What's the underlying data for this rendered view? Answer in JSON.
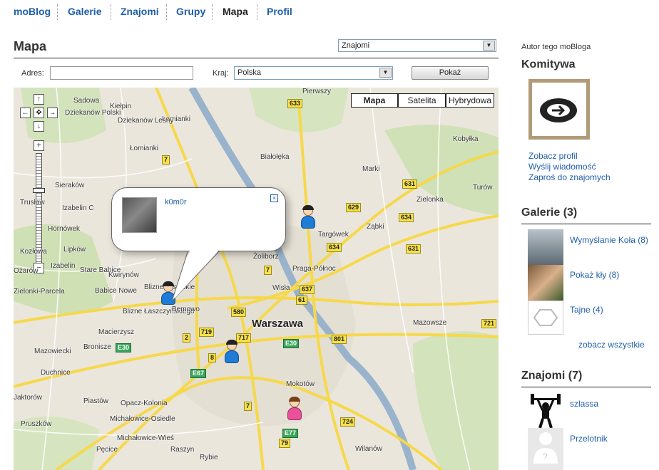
{
  "nav": {
    "items": [
      "moBlog",
      "Galerie",
      "Znajomi",
      "Grupy",
      "Mapa",
      "Profil"
    ],
    "active": "Mapa"
  },
  "page": {
    "title": "Mapa",
    "filter_select": "Znajomi"
  },
  "search": {
    "address_label": "Adres:",
    "address_value": "",
    "country_label": "Kraj:",
    "country_value": "Polska",
    "show_button": "Pokaż"
  },
  "map": {
    "types": [
      "Mapa",
      "Satelita",
      "Hybrydowa"
    ],
    "active_type": "Mapa",
    "center_label": "Warszawa",
    "places": [
      "Sadowa",
      "Kiełpin",
      "Łomianki",
      "Dziekanów Polski",
      "Dziekanów Leśny",
      "Łomianki",
      "Sieraków",
      "Izabelin C",
      "Izabelin",
      "Hornówek",
      "Lipków",
      "Stare Babice",
      "Zielonki-Parcela",
      "Babice Nowe",
      "Kwirynów",
      "Blizne Jasińskie",
      "Blizne Łaszczyńskiego",
      "Macierzysz",
      "Bronisze",
      "Mazowiecki",
      "Duchnice",
      "Piastów",
      "Pruszków",
      "Pęcice",
      "Opacz-Kolonia",
      "Michałowice-Osiedle",
      "Michałowice-Wieś",
      "Raszyn",
      "Rybie",
      "Bemowo",
      "Żoliborz",
      "Praga-Północ",
      "Targówek",
      "Ząbki",
      "Marki",
      "Zielonka",
      "Kobyłka",
      "Turów",
      "Białołęka",
      "Pierwszy",
      "Wisła",
      "Mokotów",
      "Wilanów",
      "Trusław",
      "Kozłowa",
      "Ożarów",
      "Jaktorów",
      "Mazowsze"
    ],
    "roads": [
      "633",
      "7",
      "631",
      "634",
      "629",
      "634",
      "7",
      "637",
      "61",
      "631",
      "580",
      "719",
      "2",
      "717",
      "8",
      "801",
      "724",
      "721",
      "79",
      "7",
      "E30",
      "E30",
      "E67",
      "E77"
    ],
    "popup": {
      "name": "k0m0r",
      "close_icon": "×"
    }
  },
  "sidebar": {
    "author_label": "Autor tego moBloga",
    "author_name": "Komitywa",
    "links": [
      "Zobacz profil",
      "Wyślij wiadomość",
      "Zaproś do znajomych"
    ],
    "galleries_title": "Galerie (3)",
    "galleries": [
      {
        "name": "Wymyślanie Koła (8)"
      },
      {
        "name": "Pokaż kły (8)"
      },
      {
        "name": "Tajne (4)"
      }
    ],
    "see_all": "zobacz wszystkie",
    "friends_title": "Znajomi (7)",
    "friends": [
      {
        "name": "szlassa"
      },
      {
        "name": "Przelotnik"
      }
    ]
  }
}
